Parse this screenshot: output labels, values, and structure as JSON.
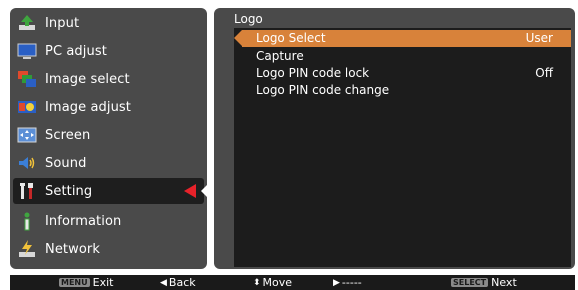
{
  "sidebar": {
    "items": [
      {
        "label": "Input",
        "icon": "input-icon"
      },
      {
        "label": "PC adjust",
        "icon": "monitor-icon"
      },
      {
        "label": "Image select",
        "icon": "image-select-icon"
      },
      {
        "label": "Image adjust",
        "icon": "image-adjust-icon"
      },
      {
        "label": "Screen",
        "icon": "screen-icon"
      },
      {
        "label": "Sound",
        "icon": "speaker-icon"
      },
      {
        "label": "Setting",
        "icon": "tools-icon"
      },
      {
        "label": "Information",
        "icon": "info-icon"
      },
      {
        "label": "Network",
        "icon": "network-icon"
      }
    ],
    "selected": "Setting"
  },
  "panel": {
    "title": "Logo",
    "items": [
      {
        "label": "Logo Select",
        "value": "User"
      },
      {
        "label": "Capture",
        "value": ""
      },
      {
        "label": "Logo PIN code lock",
        "value": "Off"
      },
      {
        "label": "Logo PIN code change",
        "value": ""
      }
    ]
  },
  "footer": {
    "menu_key": "MENU",
    "exit": "Exit",
    "back_glyph": "◀",
    "back": "Back",
    "move_glyph": "⬍",
    "move": "Move",
    "right_glyph": "▶",
    "right": "-----",
    "select_key": "SELECT",
    "next": "Next"
  },
  "colors": {
    "highlight": "#d8823a",
    "selection_arrow": "#e8222a"
  }
}
